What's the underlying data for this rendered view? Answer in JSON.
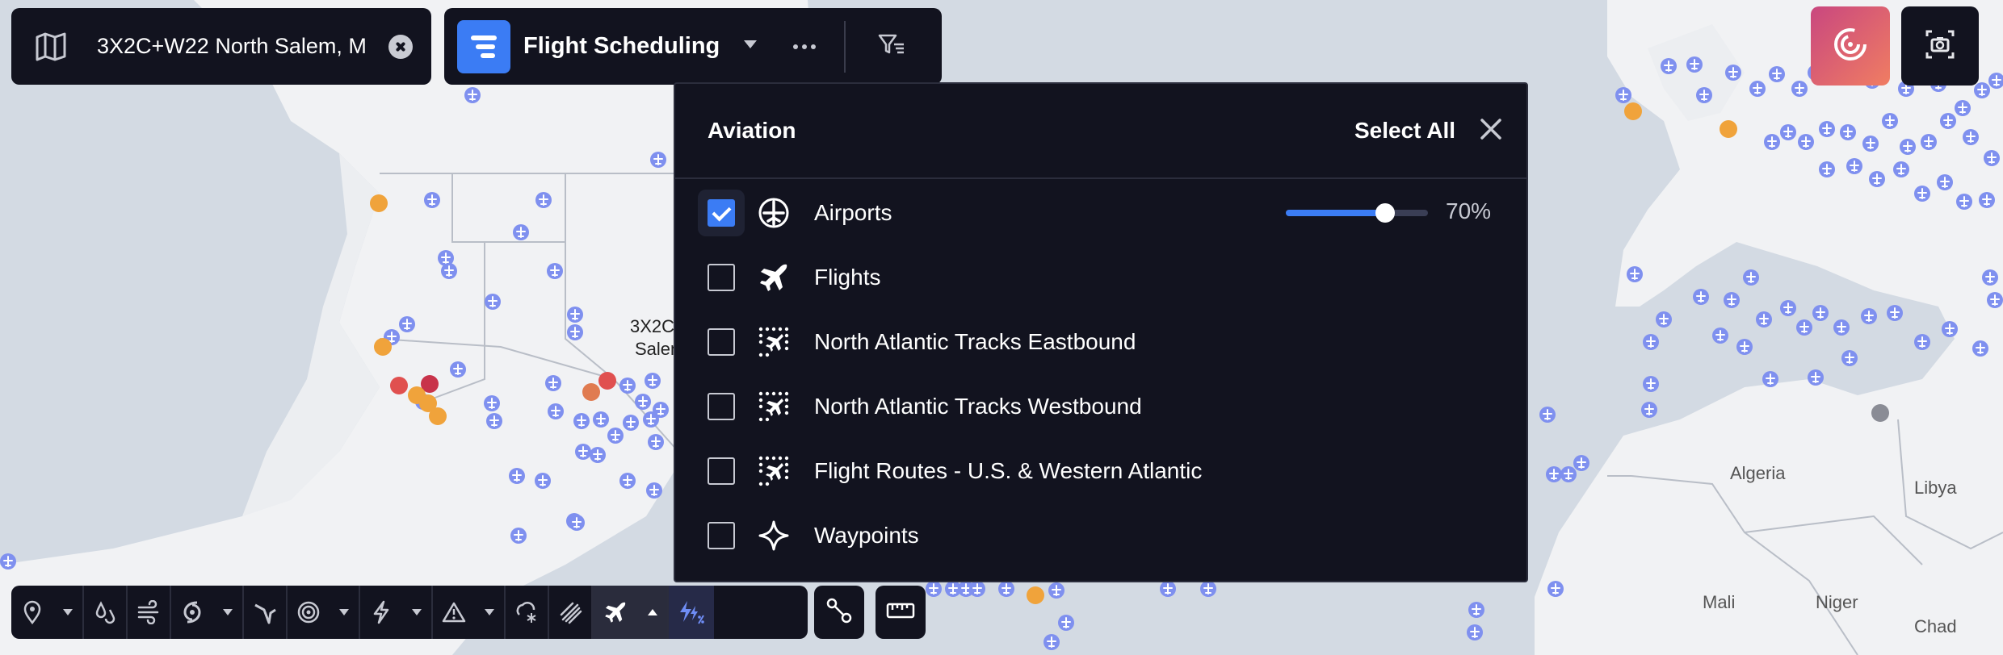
{
  "location": {
    "text": "3X2C+W22 North Salem, M"
  },
  "layer_group": {
    "title": "Flight Scheduling"
  },
  "panel": {
    "title": "Aviation",
    "select_all": "Select All",
    "items": [
      {
        "label": "Airports",
        "checked": true,
        "opacity_label": "70%",
        "opacity": 0.7,
        "icon": "airport-icon"
      },
      {
        "label": "Flights",
        "checked": false,
        "icon": "plane-icon"
      },
      {
        "label": "North Atlantic Tracks Eastbound",
        "checked": false,
        "icon": "track-icon"
      },
      {
        "label": "North Atlantic Tracks Westbound",
        "checked": false,
        "icon": "track-icon"
      },
      {
        "label": "Flight Routes - U.S. & Western Atlantic",
        "checked": false,
        "icon": "route-icon"
      },
      {
        "label": "Waypoints",
        "checked": false,
        "icon": "waypoint-icon"
      }
    ]
  },
  "map": {
    "partial_label": {
      "line1": "3X2C",
      "line2": "Salem"
    },
    "country_labels": [
      "Algeria",
      "Libya",
      "Mali",
      "Niger",
      "Chad"
    ]
  },
  "colors": {
    "accent": "#3b7cf4",
    "panel": "#12131f",
    "airport": "#7f90ef",
    "warn": "#f0a33b",
    "alert": "#e0504f"
  }
}
